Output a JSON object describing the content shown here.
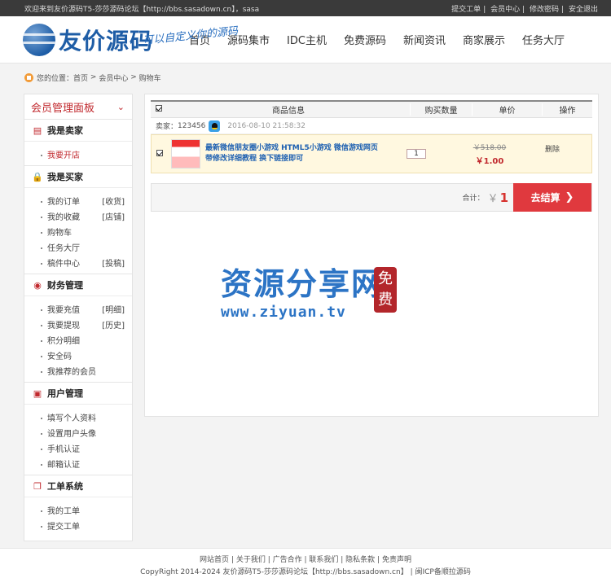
{
  "topbar": {
    "welcome": "欢迎来到友价源码T5-莎莎源码论坛【http://bbs.sasadown.cn】，sasa",
    "links": [
      "提交工单",
      "会员中心",
      "修改密码",
      "安全退出"
    ]
  },
  "header": {
    "logo_text": "友价源码",
    "slogan": "可以自定义你的源码",
    "nav": [
      "首页",
      "源码集市",
      "IDC主机",
      "免费源码",
      "新闻资讯",
      "商家展示",
      "任务大厅"
    ]
  },
  "breadcrumb": {
    "prefix": "您的位置：",
    "items": [
      "首页",
      "会员中心",
      "购物车"
    ],
    "separator": ">"
  },
  "sidebar": {
    "title": "会员管理面板",
    "groups": [
      {
        "title": "我是卖家",
        "items": [
          {
            "label": "我要开店",
            "tag": ""
          }
        ]
      },
      {
        "title": "我是买家",
        "items": [
          {
            "label": "我的订单",
            "tag": "[收货]"
          },
          {
            "label": "我的收藏",
            "tag": "[店铺]"
          },
          {
            "label": "购物车",
            "tag": ""
          },
          {
            "label": "任务大厅",
            "tag": ""
          },
          {
            "label": "稿件中心",
            "tag": "[投稿]"
          }
        ]
      },
      {
        "title": "财务管理",
        "items": [
          {
            "label": "我要充值",
            "tag": "[明细]"
          },
          {
            "label": "我要提现",
            "tag": "[历史]"
          },
          {
            "label": "积分明细",
            "tag": ""
          },
          {
            "label": "安全码",
            "tag": ""
          },
          {
            "label": "我推荐的会员",
            "tag": ""
          }
        ]
      },
      {
        "title": "用户管理",
        "items": [
          {
            "label": "填写个人资料",
            "tag": ""
          },
          {
            "label": "设置用户头像",
            "tag": ""
          },
          {
            "label": "手机认证",
            "tag": ""
          },
          {
            "label": "邮箱认证",
            "tag": ""
          }
        ]
      },
      {
        "title": "工单系统",
        "items": [
          {
            "label": "我的工单",
            "tag": ""
          },
          {
            "label": "提交工单",
            "tag": ""
          }
        ]
      }
    ]
  },
  "cart": {
    "columns": [
      "商品信息",
      "购买数量",
      "单价",
      "操作"
    ],
    "seller_label": "卖家：",
    "seller_name": "123456",
    "order_time": "2016-08-10 21:58:32",
    "item": {
      "title": "最新微信朋友圈小游戏 HTML5小游戏 微信游戏网页 带修改详细教程 换下链接即可",
      "quantity": "1",
      "old_price": "￥518.00",
      "price": "￥1.00",
      "delete_label": "删除"
    },
    "total_label": "合计：",
    "currency": "￥",
    "total": "1",
    "checkout_label": "去结算",
    "checkout_arrow": "❯"
  },
  "watermark": {
    "text_cn": "资源分享网",
    "url": "www.ziyuan.tv",
    "seal_top": "免",
    "seal_bottom": "费"
  },
  "footer": {
    "links": [
      "网站首页",
      "关于我们",
      "广告合作",
      "联系我们",
      "隐私条款",
      "免责声明"
    ],
    "copyright": "CopyRight 2014-2024 友价源码T5-莎莎源码论坛【http://bbs.sasadown.cn】 | 闽ICP备顺拉源码"
  }
}
